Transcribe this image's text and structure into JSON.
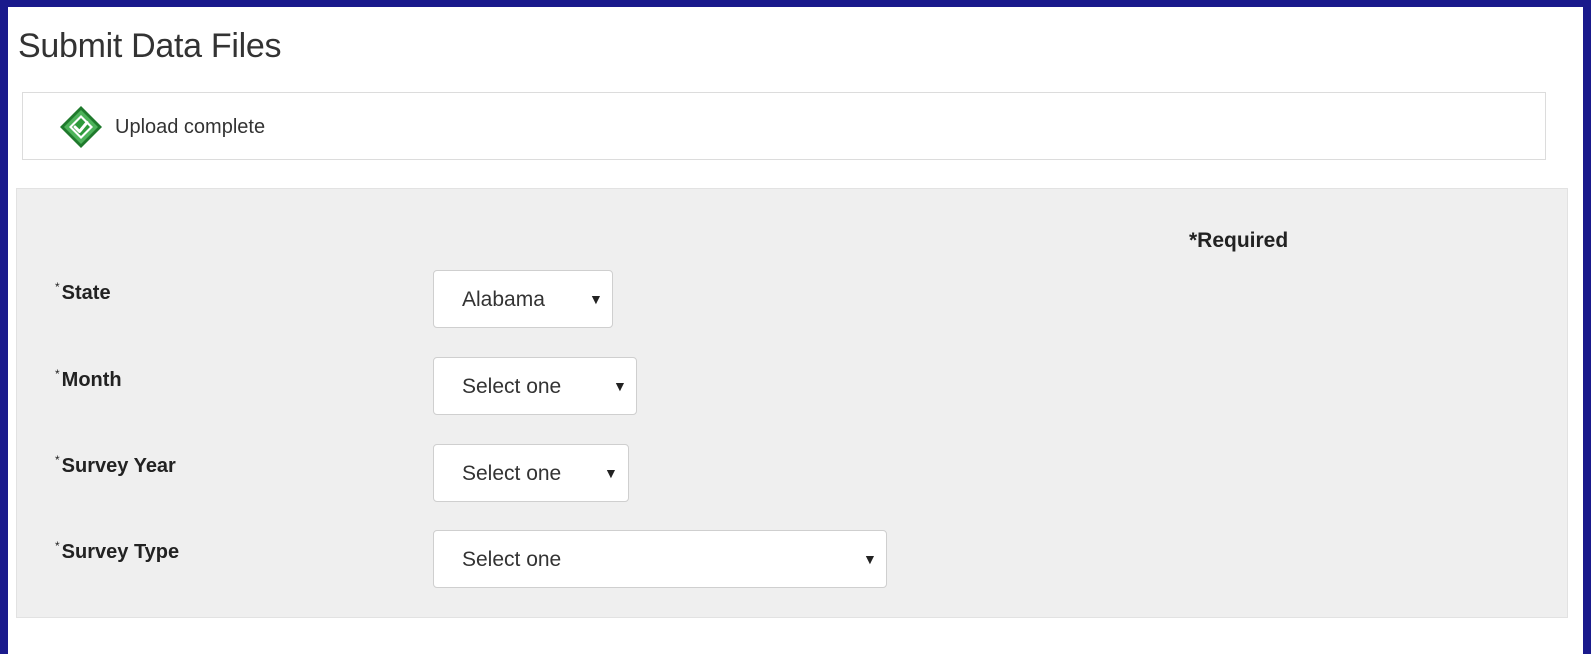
{
  "page": {
    "title": "Submit Data Files"
  },
  "notice": {
    "icon": "check-diamond-icon",
    "text": "Upload complete",
    "accent_color": "#2e8b3a"
  },
  "form": {
    "required_note": "*Required",
    "fields": [
      {
        "label": "State",
        "required_marker": "*",
        "value": "Alabama"
      },
      {
        "label": "Month",
        "required_marker": "*",
        "value": "Select one"
      },
      {
        "label": "Survey Year",
        "required_marker": "*",
        "value": "Select one"
      },
      {
        "label": "Survey Type",
        "required_marker": "*",
        "value": "Select one"
      }
    ],
    "dropdown_arrow": "▼"
  }
}
